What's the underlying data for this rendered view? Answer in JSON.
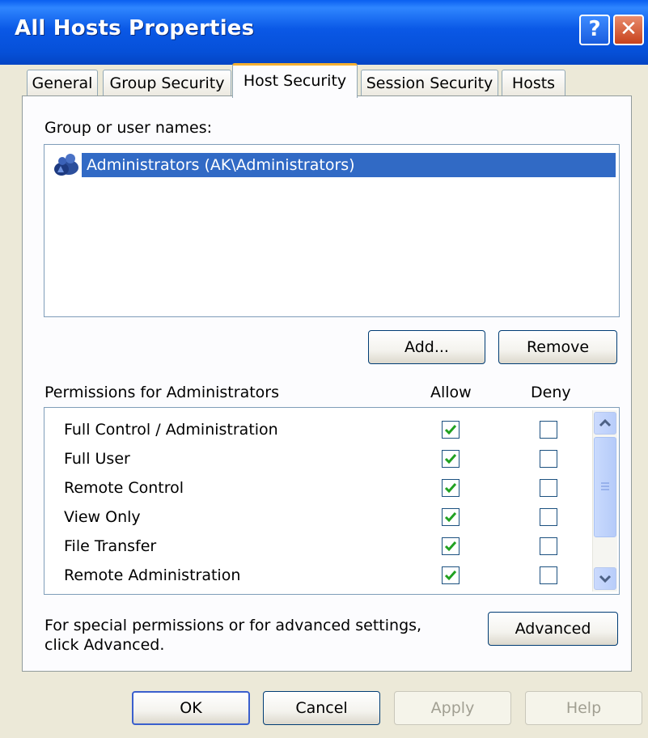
{
  "window": {
    "title": "All Hosts Properties",
    "help_glyph": "?",
    "close_glyph": "✕"
  },
  "tabs": [
    {
      "label": "General",
      "active": false
    },
    {
      "label": "Group Security",
      "active": false
    },
    {
      "label": "Host Security",
      "active": true
    },
    {
      "label": "Session Security",
      "active": false
    },
    {
      "label": "Hosts",
      "active": false
    }
  ],
  "groups": {
    "label": "Group or user names:",
    "items": [
      {
        "name": "Administrators (AK\\Administrators)",
        "icon": "user-group-icon",
        "selected": true
      }
    ],
    "add_label": "Add...",
    "remove_label": "Remove"
  },
  "permissions": {
    "label": "Permissions for Administrators",
    "allow_header": "Allow",
    "deny_header": "Deny",
    "rows": [
      {
        "name": "Full Control / Administration",
        "allow": true,
        "deny": false
      },
      {
        "name": "Full User",
        "allow": true,
        "deny": false
      },
      {
        "name": "Remote Control",
        "allow": true,
        "deny": false
      },
      {
        "name": "View Only",
        "allow": true,
        "deny": false
      },
      {
        "name": "File Transfer",
        "allow": true,
        "deny": false
      },
      {
        "name": "Remote Administration",
        "allow": true,
        "deny": false
      }
    ]
  },
  "advanced": {
    "note_line1": "For special permissions or for advanced settings,",
    "note_line2": "click Advanced.",
    "button_label": "Advanced"
  },
  "footer": {
    "ok_label": "OK",
    "cancel_label": "Cancel",
    "apply_label": "Apply",
    "help_label": "Help"
  },
  "colors": {
    "titlebar": "#0a58e6",
    "selection": "#316ac5",
    "check": "#21a121",
    "active_tab_accent": "#f4b032"
  }
}
